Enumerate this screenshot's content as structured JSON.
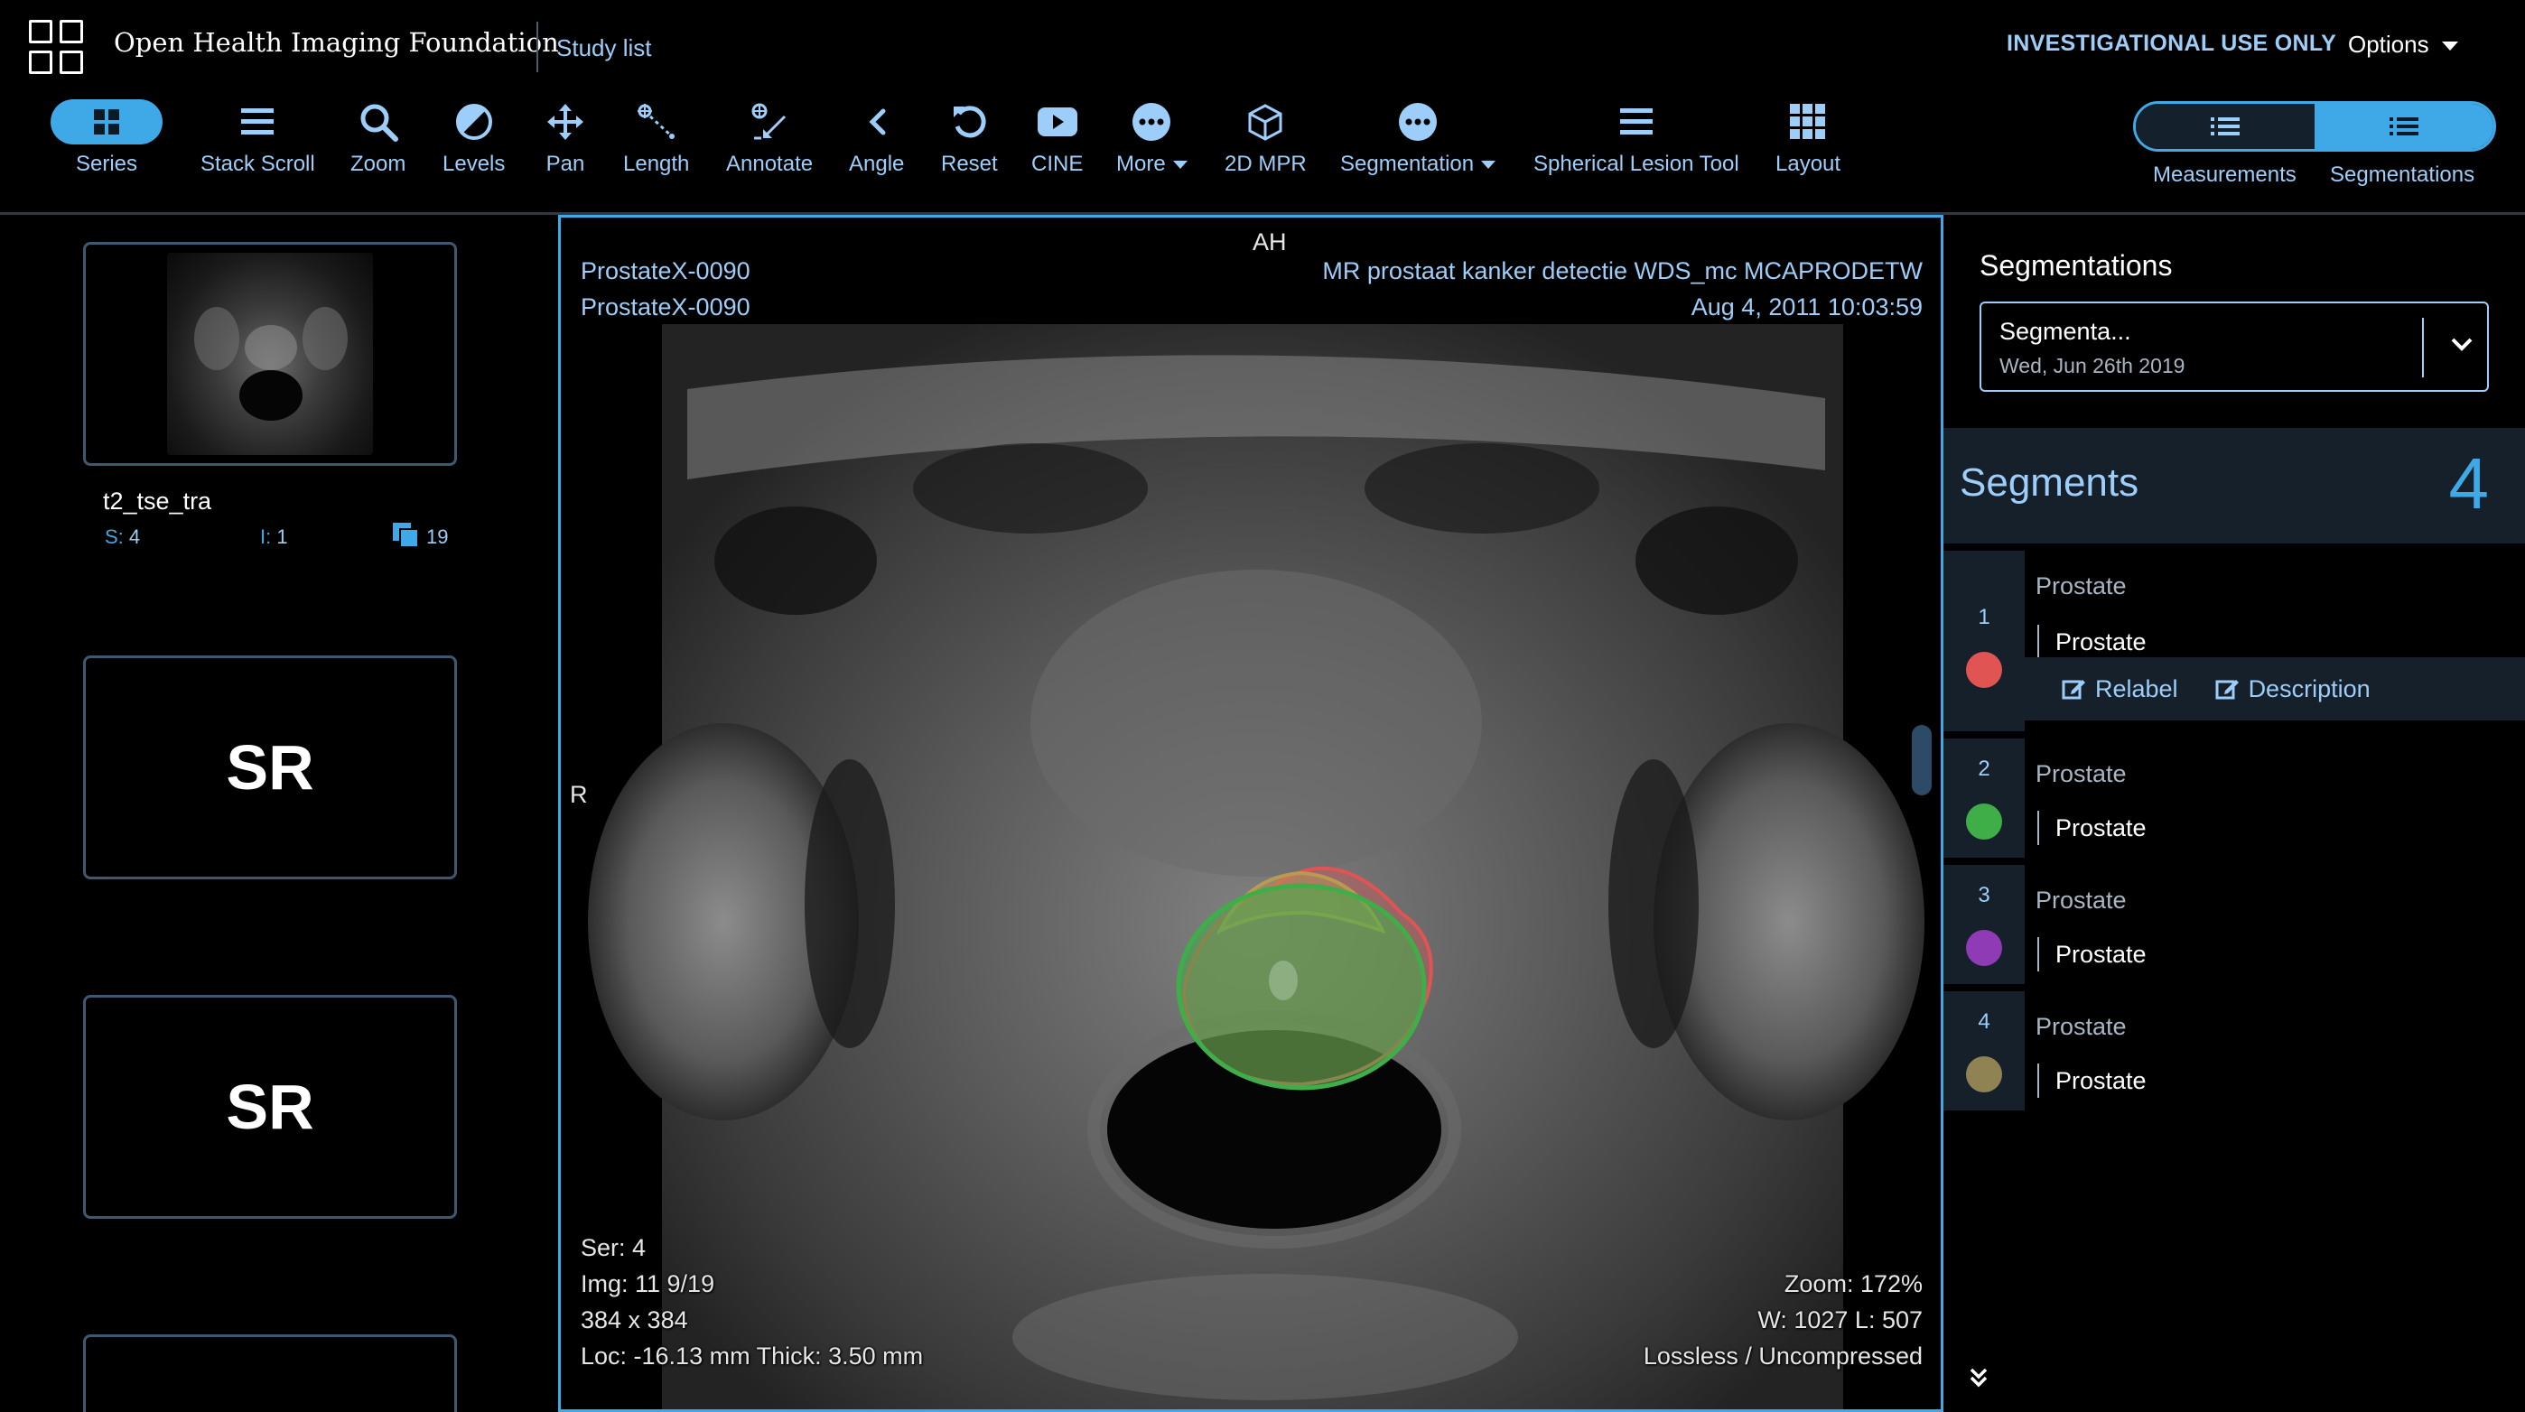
{
  "header": {
    "brand": "Open Health Imaging Foundation",
    "study_list": "Study list",
    "notice": "INVESTIGATIONAL USE ONLY",
    "options": "Options"
  },
  "toolbar": {
    "series": "Series",
    "stack_scroll": "Stack Scroll",
    "zoom": "Zoom",
    "levels": "Levels",
    "pan": "Pan",
    "length": "Length",
    "annotate": "Annotate",
    "angle": "Angle",
    "reset": "Reset",
    "cine": "CINE",
    "more": "More",
    "mpr": "2D MPR",
    "segmentation": "Segmentation",
    "spherical": "Spherical Lesion Tool",
    "layout": "Layout",
    "measurements": "Measurements",
    "segmentations": "Segmentations"
  },
  "study_panel": {
    "series": [
      {
        "name": "t2_tse_tra",
        "series_label": "S:",
        "series_num": "4",
        "instance_label": "I:",
        "instance_num": "1",
        "image_count": "19"
      },
      {
        "modality": "SR"
      },
      {
        "modality": "SR"
      }
    ]
  },
  "viewport": {
    "patient_name": "ProstateX-0090",
    "patient_id": "ProstateX-0090",
    "study_desc": "MR prostaat kanker detectie WDS_mc MCAPRODETW",
    "study_date": "Aug 4, 2011 10:03:59",
    "orient_top": "AH",
    "orient_left": "R",
    "ser": "Ser: 4",
    "img": "Img: 11 9/19",
    "dims": "384 x 384",
    "loc": "Loc: -16.13 mm Thick: 3.50 mm",
    "zoom": "Zoom: 172%",
    "wl": "W: 1027 L: 507",
    "compression": "Lossless / Uncompressed",
    "overlay_colors": {
      "green": "#3fae49",
      "red": "#e05454",
      "olive": "#b89a52"
    }
  },
  "seg_panel": {
    "title": "Segmentations",
    "selected_name": "Segmenta...",
    "selected_date": "Wed, Jun 26th 2019",
    "segments_label": "Segments",
    "segments_count": "4",
    "relabel": "Relabel",
    "description": "Description",
    "segments": [
      {
        "index": "1",
        "label": "Prostate",
        "desc": "Prostate",
        "color": "#e05454"
      },
      {
        "index": "2",
        "label": "Prostate",
        "desc": "Prostate",
        "color": "#3fae49"
      },
      {
        "index": "3",
        "label": "Prostate",
        "desc": "Prostate",
        "color": "#8e3bb5"
      },
      {
        "index": "4",
        "label": "Prostate",
        "desc": "Prostate",
        "color": "#8f8354"
      }
    ]
  }
}
